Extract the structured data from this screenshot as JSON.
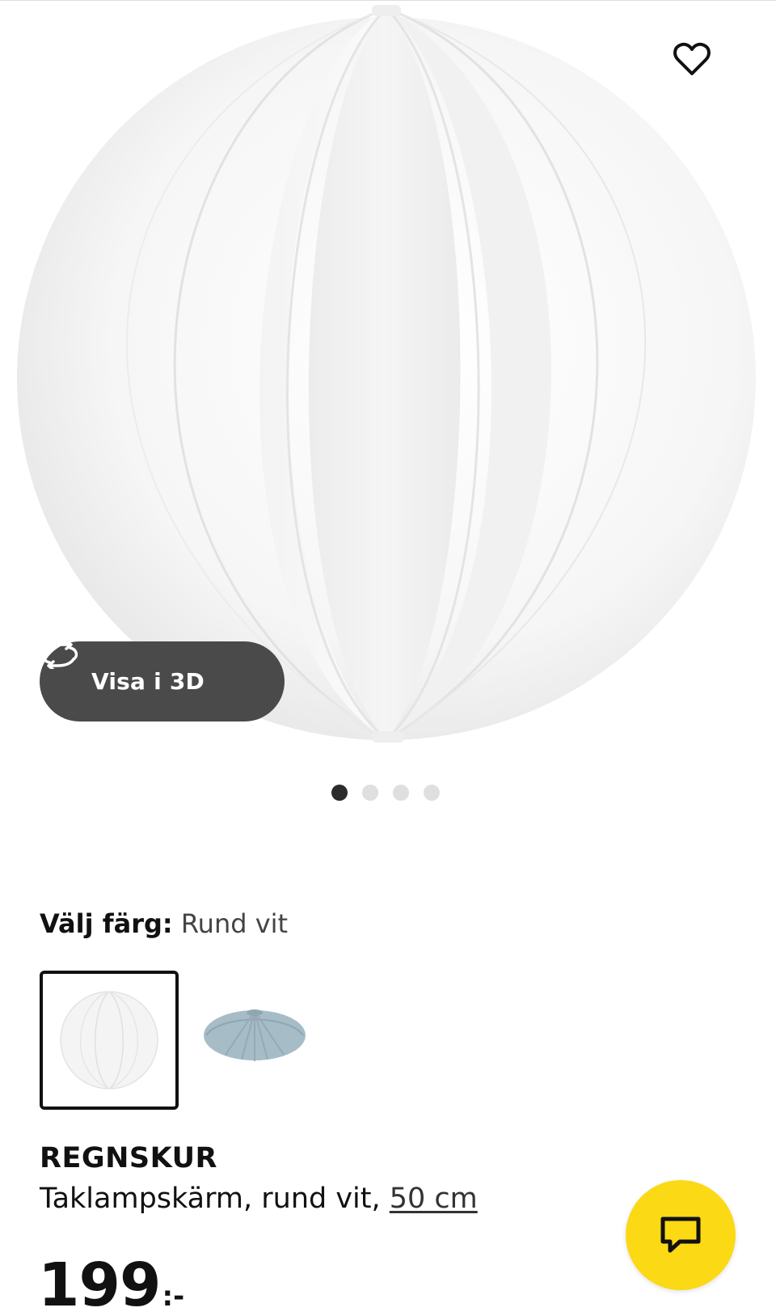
{
  "product": {
    "view3d_label": "Visa i 3D",
    "color_label": "Välj färg:",
    "color_value": "Rund vit",
    "name": "REGNSKUR",
    "description": "Taklampskärm, rund vit, ",
    "size_link": "50 cm",
    "price": "199",
    "price_suffix": ":-"
  },
  "gallery": {
    "total_images": 4,
    "active_index": 0
  },
  "swatches": [
    {
      "name": "Rund vit",
      "selected": true,
      "color": "#f2f2f2"
    },
    {
      "name": "blue lamp shade",
      "selected": false,
      "color": "#9fb7c2"
    }
  ],
  "icons": {
    "favorite": "heart-icon",
    "rotate": "rotate-3d-icon",
    "chat": "chat-icon"
  },
  "colors": {
    "accent_yellow": "#fbd914",
    "dark_pill": "#4a4a4a",
    "text": "#111111"
  }
}
